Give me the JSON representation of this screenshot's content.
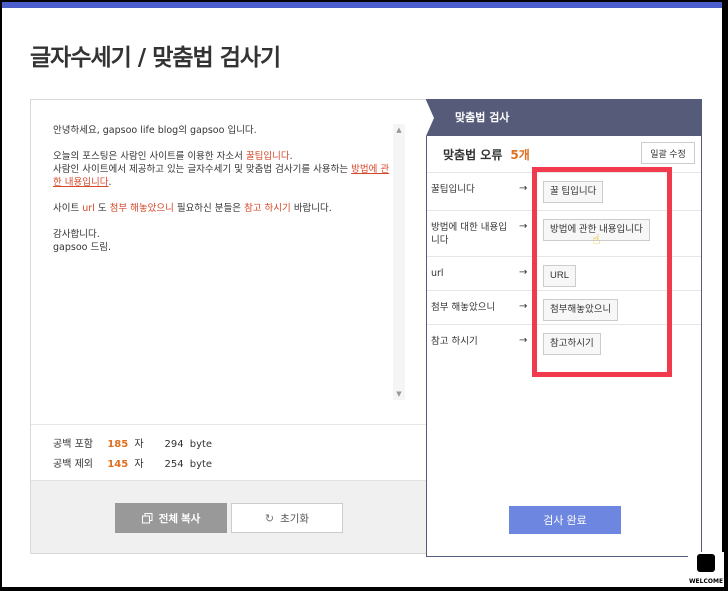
{
  "page": {
    "title": "글자수세기 / 맞춤법 검사기"
  },
  "text": {
    "line1": "안녕하세요, gapsoo life blog의 gapsoo 입니다.",
    "para2_a": "오늘의 포스팅은 사람인 사이트를 이용한 자소서 ",
    "para2_b": "꿀팁입니다",
    "para2_c": ".",
    "para2_d": "사람인 사이트에서 제공하고 있는 글자수세기 및 맞춤법 검사기를 사용하는 ",
    "para2_e": "방법에 관한 내용입니다",
    "para2_f": ".",
    "para3_a": "사이트 ",
    "para3_b": "url",
    "para3_c": " 도 ",
    "para3_d": "첨부 해놓았으니",
    "para3_e": " 필요하신 분들은 ",
    "para3_f": "참고 하시기",
    "para3_g": " 바랍니다.",
    "para4_a": "감사합니다.",
    "para4_b": "gapsoo 드림."
  },
  "stats": {
    "with_space_label": "공백 포함",
    "with_space_count": "185",
    "with_space_unit": "자",
    "with_space_bytes": "294",
    "with_space_byte_unit": "byte",
    "no_space_label": "공백 제외",
    "no_space_count": "145",
    "no_space_unit": "자",
    "no_space_bytes": "254",
    "no_space_byte_unit": "byte"
  },
  "buttons": {
    "copy_all": "전체 복사",
    "reset": "초기화",
    "fix_all": "일괄 수정",
    "done": "검사 완료"
  },
  "checker": {
    "header": "맞춤법 검사",
    "error_label": "맞춤법 오류",
    "error_count": "5개",
    "arrow": "→",
    "items": [
      {
        "original": "꿀팁입니다",
        "suggestion": "꿀 팁입니다"
      },
      {
        "original": "방법에 대한 내용입니다",
        "suggestion": "방법에 관한 내용입니다"
      },
      {
        "original": "url",
        "suggestion": "URL"
      },
      {
        "original": "첨부 해놓았으니",
        "suggestion": "첨부해놓았으니"
      },
      {
        "original": "참고 하시기",
        "suggestion": "참고하시기"
      }
    ]
  },
  "logo": {
    "text": "WELCOME"
  },
  "colors": {
    "accent": "#4a5fcb",
    "highlight": "#f23a4e",
    "orange": "#e07020",
    "done_button": "#6d86e0",
    "header": "#565b79"
  },
  "icons": {
    "copy": "copy-icon",
    "reset": "refresh-icon",
    "cursor": "hand-pointer-icon",
    "scroll_up": "triangle-up-icon",
    "scroll_down": "triangle-down-icon"
  }
}
